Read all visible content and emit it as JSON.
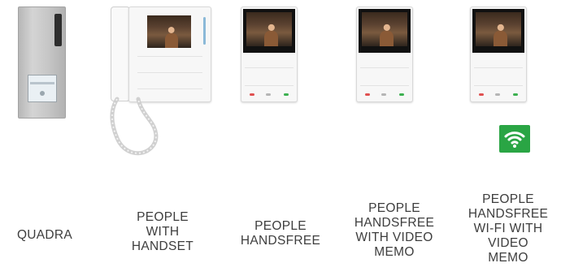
{
  "products": [
    {
      "id": "quadra",
      "caption": "QUADRA"
    },
    {
      "id": "people-handset",
      "caption": "PEOPLE\nWITH\nHANDSET"
    },
    {
      "id": "people-handsfree",
      "caption": "PEOPLE\nHANDSFREE"
    },
    {
      "id": "people-handsfree-video",
      "caption": "PEOPLE\nHANDSFREE\nWITH VIDEO\nMEMO"
    },
    {
      "id": "people-handsfree-wifi",
      "caption": "PEOPLE\nHANDSFREE\nWI-FI WITH\nVIDEO\nMEMO"
    }
  ],
  "wifi_badge": {
    "icon": "wifi-icon",
    "color": "#2aa544"
  },
  "colors": {
    "caption_text": "#3d3d3d",
    "call_red": "#e05050",
    "call_green": "#3cb050"
  }
}
